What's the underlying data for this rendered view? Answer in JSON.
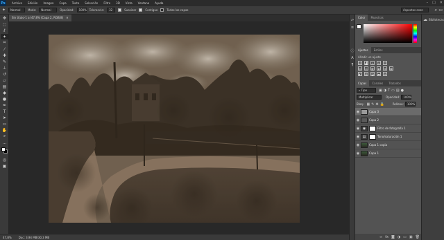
{
  "app": {
    "logo": "Ps",
    "menus": [
      "Archivo",
      "Edición",
      "Imagen",
      "Capa",
      "Texto",
      "Selección",
      "Filtro",
      "3D",
      "Vista",
      "Ventana",
      "Ayuda"
    ],
    "window_controls": [
      "–",
      "□",
      "✕"
    ]
  },
  "options": {
    "feather_value": "Normal",
    "mode_label": "Modo:",
    "mode_value": "Normal",
    "opacity_label": "Opacidad:",
    "opacity_value": "100%",
    "tolerance_label": "Tolerancia:",
    "tolerance_value": "32",
    "antialias_label": "Suavizar",
    "contiguous_label": "Contiguo",
    "all_layers_label": "Todas las capas",
    "workspace": "Aspectos esen"
  },
  "document": {
    "tab_title": "Sin título-1 al 47,8% (Capa 2, RGB/8)",
    "close": "✕"
  },
  "status": {
    "zoom": "47,8%",
    "doc_info": "Doc: 3,94 MB/30,3 MB"
  },
  "panels": {
    "color": {
      "tabs": [
        "Color",
        "Muestras"
      ],
      "fg": "#ffffff",
      "bg": "#000000"
    },
    "adjustments": {
      "tabs": [
        "Ajustes",
        "Estilos"
      ],
      "title": "Añadir un ajuste"
    },
    "layers": {
      "tabs": [
        "Capas",
        "Canales",
        "Trazados"
      ],
      "kind_filter": "Tipo",
      "blend_mode": "Multiplicar",
      "opacity_label": "Opacidad:",
      "opacity_value": "100%",
      "lock_label": "Bloq.:",
      "fill_label": "Relleno:",
      "fill_value": "100%",
      "items": [
        {
          "name": "Capa 3",
          "selected": true,
          "has_mask": false
        },
        {
          "name": "Capa 2",
          "selected": false,
          "has_mask": false
        },
        {
          "name": "Filtro de fotografía 1",
          "selected": false,
          "has_mask": true
        },
        {
          "name": "Tono/saturación 1",
          "selected": false,
          "has_mask": true
        },
        {
          "name": "Capa 1 copia",
          "selected": false,
          "has_mask": false
        },
        {
          "name": "Capa 1",
          "selected": false,
          "has_mask": false
        }
      ]
    },
    "libraries": {
      "label": "Bibliotecas"
    }
  },
  "colors": {
    "chrome_dark": "#2b2b2b",
    "panel": "#535353",
    "canvas_bg": "#282828",
    "photo_tone": "#6d5a45"
  }
}
